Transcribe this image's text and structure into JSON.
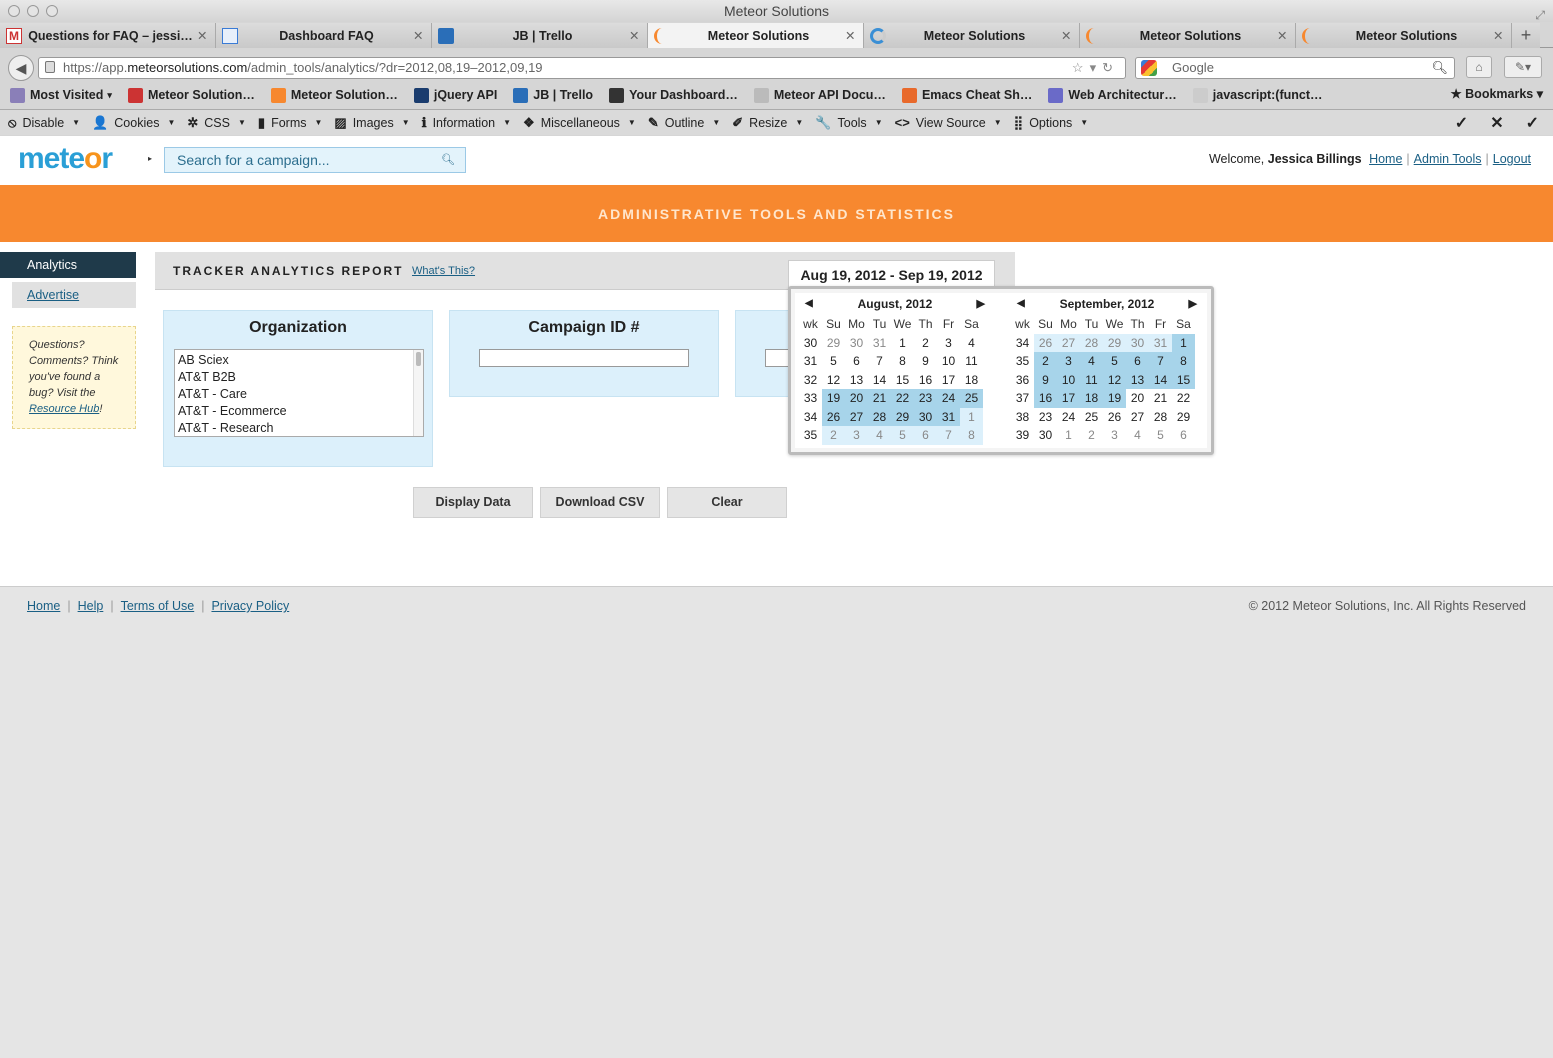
{
  "window": {
    "title": "Meteor Solutions"
  },
  "tabs": [
    {
      "label": "Questions for FAQ – jessi…",
      "icon": "gmail-icon",
      "active": false
    },
    {
      "label": "Dashboard FAQ",
      "icon": "doc-icon",
      "active": false
    },
    {
      "label": "JB | Trello",
      "icon": "trello-icon",
      "active": false
    },
    {
      "label": "Meteor Solutions",
      "icon": "meteor-icon",
      "active": true
    },
    {
      "label": "Meteor Solutions",
      "icon": "loading-icon",
      "active": false
    },
    {
      "label": "Meteor Solutions",
      "icon": "meteor-icon",
      "active": false
    },
    {
      "label": "Meteor Solutions",
      "icon": "meteor-icon",
      "active": false
    }
  ],
  "url": {
    "prefix": "https://app.",
    "domain": "meteorsolutions.com",
    "path": "/admin_tools/analytics/?dr=2012,08,19–2012,09,19"
  },
  "search": {
    "placeholder": "Google"
  },
  "bookmarks": {
    "items": [
      "Most Visited",
      "Meteor Solution…",
      "Meteor Solution…",
      "jQuery API",
      "JB | Trello",
      "Your Dashboard…",
      "Meteor API Docu…",
      "Emacs Cheat Sh…",
      "Web Architectur…",
      "javascript:(funct…"
    ],
    "right": "Bookmarks"
  },
  "devbar": {
    "items": [
      "Disable",
      "Cookies",
      "CSS",
      "Forms",
      "Images",
      "Information",
      "Miscellaneous",
      "Outline",
      "Resize",
      "Tools",
      "View Source",
      "Options"
    ]
  },
  "header": {
    "logo_a": "mete",
    "logo_o": "o",
    "logo_b": "r",
    "campaign_search": "Search for a campaign...",
    "welcome": "Welcome,",
    "user": "Jessica Billings",
    "links": [
      "Home",
      "Admin Tools",
      "Logout"
    ]
  },
  "banner": {
    "title": "ADMINISTRATIVE TOOLS AND STATISTICS"
  },
  "sidebar": {
    "active": "Analytics",
    "item": "Advertise",
    "help_text": "Questions? Comments? Think you've found a bug? Visit the",
    "help_link": "Resource Hub",
    "help_end": "!"
  },
  "report": {
    "title": "TRACKER ANALYTICS REPORT",
    "whats_this": "What's This?",
    "date_range": "Aug 19, 2012 - Sep 19, 2012"
  },
  "panels": {
    "organization": {
      "title": "Organization",
      "options": [
        "AB Sciex",
        "AT&T B2B",
        "AT&T - Care",
        "AT&T - Ecommerce",
        "AT&T - Research"
      ]
    },
    "campaign": {
      "title": "Campaign ID #",
      "value": ""
    }
  },
  "buttons": {
    "display": "Display Data",
    "download": "Download CSV",
    "clear": "Clear"
  },
  "calendar": {
    "headers": [
      "wk",
      "Su",
      "Mo",
      "Tu",
      "We",
      "Th",
      "Fr",
      "Sa"
    ],
    "months": [
      {
        "title": "August, 2012",
        "weeks": [
          {
            "wk": "30",
            "days": [
              "29",
              "30",
              "31",
              "1",
              "2",
              "3",
              "4"
            ],
            "other": [
              0,
              1,
              2
            ],
            "sel": []
          },
          {
            "wk": "31",
            "days": [
              "5",
              "6",
              "7",
              "8",
              "9",
              "10",
              "11"
            ],
            "other": [],
            "sel": []
          },
          {
            "wk": "32",
            "days": [
              "12",
              "13",
              "14",
              "15",
              "16",
              "17",
              "18"
            ],
            "other": [],
            "sel": []
          },
          {
            "wk": "33",
            "days": [
              "19",
              "20",
              "21",
              "22",
              "23",
              "24",
              "25"
            ],
            "other": [],
            "sel": [
              0,
              1,
              2,
              3,
              4,
              5,
              6
            ]
          },
          {
            "wk": "34",
            "days": [
              "26",
              "27",
              "28",
              "29",
              "30",
              "31",
              "1"
            ],
            "other": [
              6
            ],
            "sel": [
              0,
              1,
              2,
              3,
              4,
              5
            ],
            "lite": [
              6
            ]
          },
          {
            "wk": "35",
            "days": [
              "2",
              "3",
              "4",
              "5",
              "6",
              "7",
              "8"
            ],
            "other": [
              0,
              1,
              2,
              3,
              4,
              5,
              6
            ],
            "sel": [],
            "lite": [
              0,
              1,
              2,
              3,
              4,
              5,
              6
            ]
          }
        ]
      },
      {
        "title": "September, 2012",
        "weeks": [
          {
            "wk": "34",
            "days": [
              "26",
              "27",
              "28",
              "29",
              "30",
              "31",
              "1"
            ],
            "other": [
              0,
              1,
              2,
              3,
              4,
              5
            ],
            "sel": [
              6
            ],
            "lite": [
              0,
              1,
              2,
              3,
              4,
              5
            ]
          },
          {
            "wk": "35",
            "days": [
              "2",
              "3",
              "4",
              "5",
              "6",
              "7",
              "8"
            ],
            "other": [],
            "sel": [
              0,
              1,
              2,
              3,
              4,
              5,
              6
            ]
          },
          {
            "wk": "36",
            "days": [
              "9",
              "10",
              "11",
              "12",
              "13",
              "14",
              "15"
            ],
            "other": [],
            "sel": [
              0,
              1,
              2,
              3,
              4,
              5,
              6
            ]
          },
          {
            "wk": "37",
            "days": [
              "16",
              "17",
              "18",
              "19",
              "20",
              "21",
              "22"
            ],
            "other": [],
            "sel": [
              0,
              1,
              2,
              3
            ]
          },
          {
            "wk": "38",
            "days": [
              "23",
              "24",
              "25",
              "26",
              "27",
              "28",
              "29"
            ],
            "other": [],
            "sel": []
          },
          {
            "wk": "39",
            "days": [
              "30",
              "1",
              "2",
              "3",
              "4",
              "5",
              "6"
            ],
            "other": [
              1,
              2,
              3,
              4,
              5,
              6
            ],
            "sel": []
          }
        ]
      }
    ]
  },
  "footer": {
    "links": [
      "Home",
      "Help",
      "Terms of Use",
      "Privacy Policy"
    ],
    "copyright": "© 2012 Meteor Solutions, Inc. All Rights Reserved"
  }
}
